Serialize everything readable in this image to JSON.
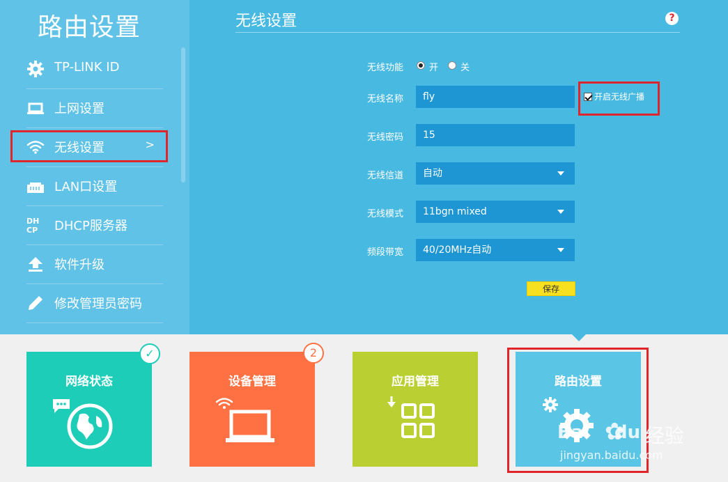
{
  "sidebar": {
    "title": "路由设置",
    "items": [
      {
        "label": "TP-LINK ID",
        "icon": "gear-icon"
      },
      {
        "label": "上网设置",
        "icon": "laptop-icon"
      },
      {
        "label": "无线设置",
        "icon": "wifi-icon",
        "arrow": ">"
      },
      {
        "label": "LAN口设置",
        "icon": "ethernet-port-icon"
      },
      {
        "label": "DHCP服务器",
        "icon": "dhcp-icon",
        "icon_text_top": "DH",
        "icon_text_bottom": "CP"
      },
      {
        "label": "软件升级",
        "icon": "upload-icon"
      },
      {
        "label": "修改管理员密码",
        "icon": "pencil-icon"
      }
    ]
  },
  "main": {
    "title": "无线设置",
    "help": "?",
    "form": {
      "wireless_function": {
        "label": "无线功能",
        "on_label": "开",
        "off_label": "关",
        "selected": "开"
      },
      "ssid": {
        "label": "无线名称",
        "value": "fly",
        "broadcast_label": "开启无线广播",
        "broadcast_checked": true
      },
      "password": {
        "label": "无线密码",
        "value": "15"
      },
      "channel": {
        "label": "无线信道",
        "value": "自动"
      },
      "mode": {
        "label": "无线模式",
        "value": "11bgn mixed"
      },
      "bandwidth": {
        "label": "频段带宽",
        "value": "40/20MHz自动"
      },
      "save_label": "保存"
    }
  },
  "tiles": [
    {
      "title": "网络状态",
      "color": "#1dcdb8",
      "badge": "✓",
      "icon": "globe-chat-icon"
    },
    {
      "title": "设备管理",
      "color": "#ff7043",
      "badge": "2",
      "icon": "laptop-wifi-icon"
    },
    {
      "title": "应用管理",
      "color": "#b9cf32",
      "icon": "app-grid-icon"
    },
    {
      "title": "路由设置",
      "color": "#5bc5e6",
      "icon": "gears-icon"
    }
  ],
  "watermark": {
    "brand": "Bai",
    "brand2": "du",
    "text": "经验",
    "url": "jingyan.baidu.com"
  },
  "colors": {
    "highlight": "#e0262b",
    "save_button": "#f7e01f"
  }
}
